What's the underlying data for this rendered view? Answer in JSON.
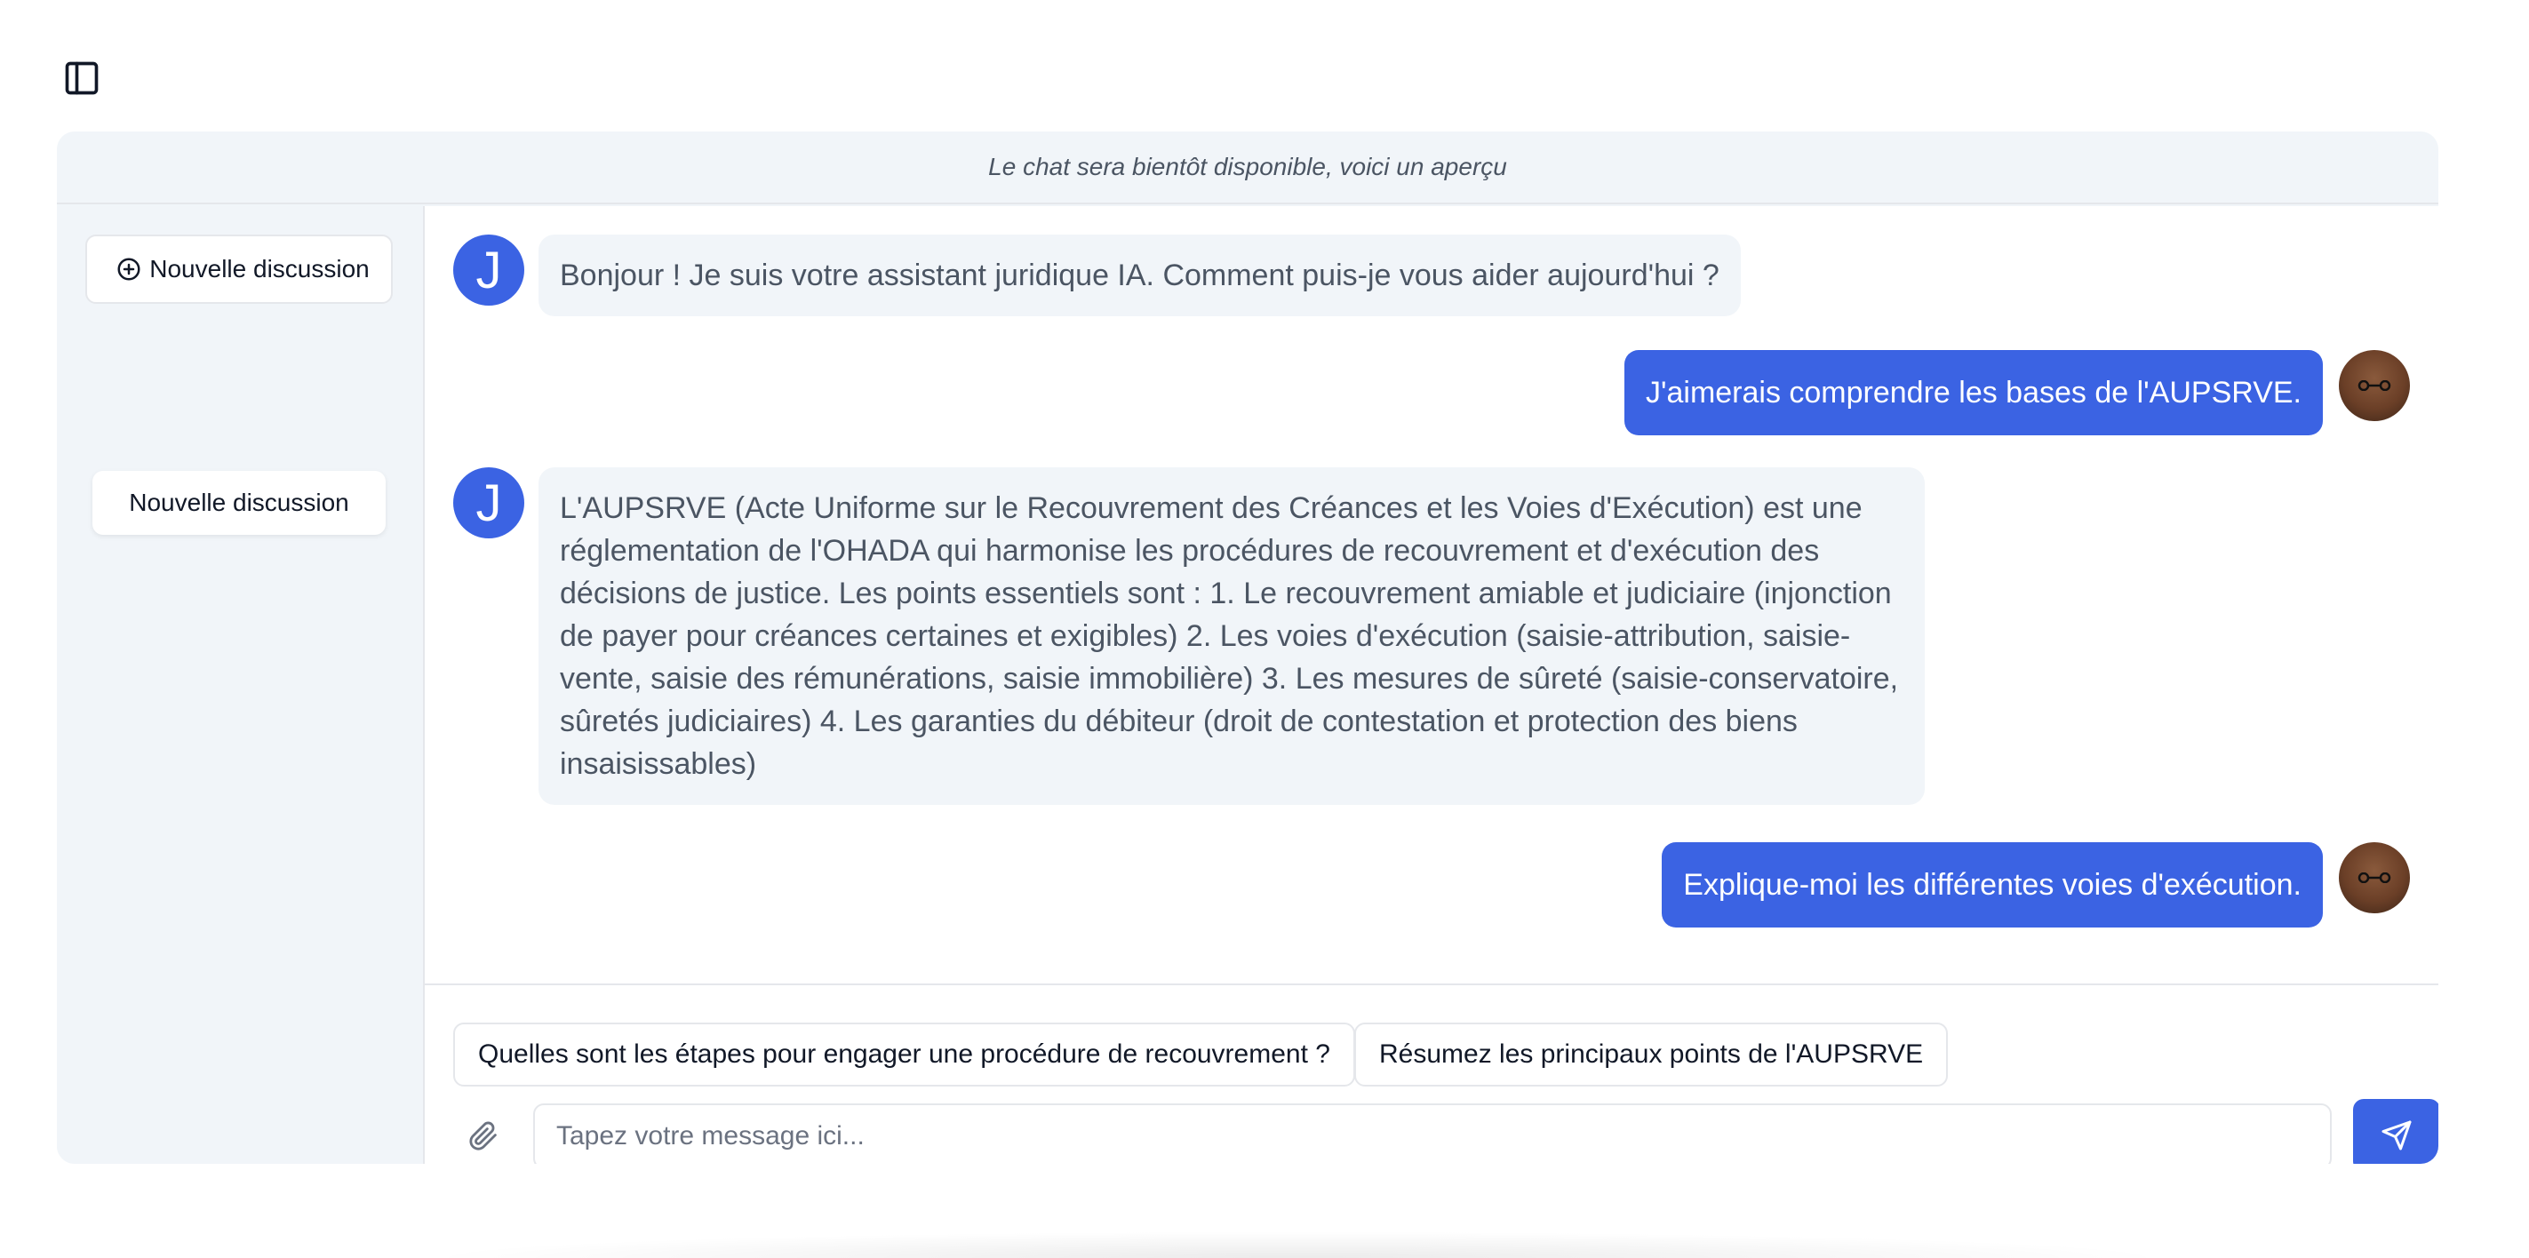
{
  "banner": {
    "text": "Le chat sera bientôt disponible, voici un aperçu"
  },
  "sidebar": {
    "new_chat_label": "Nouvelle discussion",
    "history": [
      {
        "label": "Nouvelle discussion"
      }
    ]
  },
  "messages": [
    {
      "role": "assistant",
      "avatar_letter": "J",
      "text": "Bonjour ! Je suis votre assistant juridique IA. Comment puis-je vous aider aujourd'hui ?"
    },
    {
      "role": "user",
      "text": "J'aimerais comprendre les bases de l'AUPSRVE."
    },
    {
      "role": "assistant",
      "avatar_letter": "J",
      "text": "L'AUPSRVE (Acte Uniforme sur le Recouvrement des Créances et les Voies d'Exécution) est une réglementation de l'OHADA qui harmonise les procédures de recouvrement et d'exécution des décisions de justice. Les points essentiels sont : 1. Le recouvrement amiable et judiciaire (injonction de payer pour créances certaines et exigibles) 2. Les voies d'exécution (saisie-attribution, saisie-vente, saisie des rémunérations, saisie immobilière) 3. Les mesures de sûreté (saisie-conservatoire, sûretés judiciaires) 4. Les garanties du débiteur (droit de contestation et protection des biens insaisissables)"
    },
    {
      "role": "user",
      "text": "Explique-moi les différentes voies d'exécution."
    }
  ],
  "suggestions": [
    "Quelles sont les étapes pour engager une procédure de recouvrement ?",
    "Résumez les principaux points de l'AUPSRVE"
  ],
  "composer": {
    "placeholder": "Tapez votre message ici...",
    "value": ""
  },
  "icons": {
    "sidebar_toggle": "sidebar-panel-icon",
    "new_chat": "plus-circle-icon",
    "attach": "paperclip-icon",
    "send": "send-plane-icon"
  },
  "colors": {
    "accent": "#3b63e3",
    "panel_bg": "#f1f5f9",
    "assistant_text": "#4b5563"
  }
}
